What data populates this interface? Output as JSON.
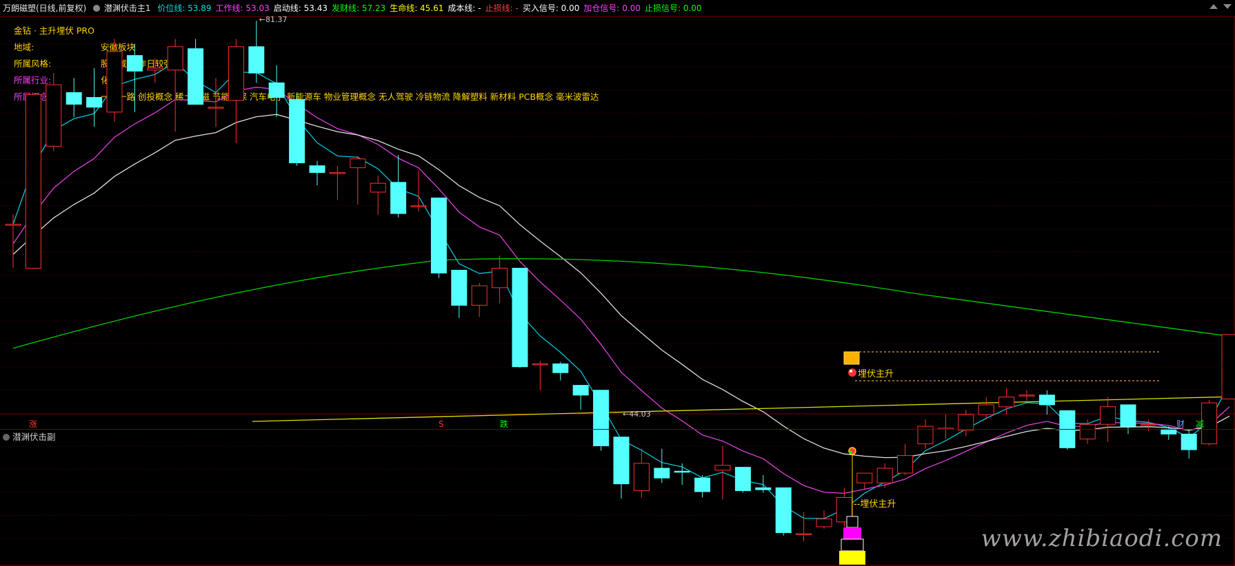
{
  "header": {
    "app_title": "万朗磁塑(日线,前复权)",
    "indicator_name": "潜渊伏击主1",
    "items": [
      {
        "label": "价位线: 53.89",
        "color": "#00e0e0"
      },
      {
        "label": "工作线: 53.03",
        "color": "#ff40ff"
      },
      {
        "label": "启动线: 53.43",
        "color": "#ffffff"
      },
      {
        "label": "发财线: 57.23",
        "color": "#00ff00"
      },
      {
        "label": "生命线: 45.61",
        "color": "#ffff00"
      },
      {
        "label": "成本线: -",
        "color": "#ffffff"
      },
      {
        "label": "止损线: -",
        "color": "#ff4040"
      },
      {
        "label": "买入信号: 0.00",
        "color": "#ffffff"
      },
      {
        "label": "加仓信号: 0.00",
        "color": "#ff40ff"
      },
      {
        "label": "止损信号: 0.00",
        "color": "#00ff00"
      }
    ]
  },
  "info": {
    "line1": "金钻 · 主升埋伏 PRO",
    "region_label": "地域:",
    "region_value": "安徽板块",
    "style_label": "所属风格:",
    "style_value": "股东减持 昨日较强",
    "industry_label": "所属行业:",
    "industry_value": "化工",
    "concept_label": "所属概念:",
    "concept_value": "一带一路 创投概念 稀土永磁 节能环保 汽车电子 新能源车 物业管理概念 无人驾驶 冷链物流 降解塑料 新材料 PCB概念 毫米波雷达"
  },
  "annotations": {
    "high": "81.37",
    "low": "44.03",
    "signal": "埋伏主升"
  },
  "bottom_markers": {
    "zhang": "涨",
    "s": "S",
    "die": "跌",
    "cai": "财",
    "jian": "减"
  },
  "sub_panel": {
    "title": "潜渊伏击副",
    "signal": "--埋伏主升"
  },
  "watermark": "www.zhibiaodi.com",
  "colors": {
    "up": "#ff3030",
    "down": "#54ffff",
    "price_line": "#00c8d8",
    "work_line": "#e040e0",
    "start_line": "#e0e0e0",
    "fortune_line": "#00d000",
    "life_line": "#e0e000",
    "grid": "#5a0000"
  },
  "candles": [
    [
      60.5,
      60.5,
      56.0,
      61.5
    ],
    [
      56.0,
      73.8,
      56.0,
      73.8
    ],
    [
      68.5,
      74.8,
      68.0,
      76.0
    ],
    [
      74.0,
      72.8,
      71.5,
      75.5
    ],
    [
      73.5,
      72.5,
      70.5,
      76.5
    ],
    [
      72.0,
      78.2,
      71.0,
      79.5
    ],
    [
      77.8,
      76.2,
      72.0,
      79.0
    ],
    [
      76.3,
      76.5,
      75.0,
      77.5
    ],
    [
      76.3,
      78.7,
      70.0,
      79.5
    ],
    [
      78.5,
      72.8,
      73.0,
      79.5
    ],
    [
      72.5,
      72.5,
      70.5,
      75.5
    ],
    [
      73.2,
      78.7,
      68.8,
      79.5
    ],
    [
      78.7,
      76.0,
      75.0,
      81.37
    ],
    [
      75.0,
      73.5,
      71.5,
      76.8
    ],
    [
      73.3,
      66.8,
      66.5,
      74.0
    ],
    [
      66.5,
      65.8,
      64.5,
      67.0
    ],
    [
      65.8,
      65.8,
      63.0,
      66.5
    ],
    [
      66.3,
      67.2,
      62.5,
      67.5
    ],
    [
      63.8,
      64.7,
      61.5,
      65.5
    ],
    [
      64.8,
      61.6,
      61.2,
      67.6
    ],
    [
      62.4,
      62.4,
      61.8,
      66.0
    ],
    [
      63.2,
      55.5,
      55.0,
      63.2
    ],
    [
      55.8,
      52.2,
      50.9,
      55.8
    ],
    [
      52.2,
      54.2,
      51.0,
      54.5
    ],
    [
      54.0,
      56.0,
      52.4,
      57.3
    ],
    [
      56.0,
      45.9,
      45.8,
      56.0
    ],
    [
      46.2,
      46.2,
      43.5,
      46.5
    ],
    [
      46.2,
      45.3,
      44.5,
      46.4
    ],
    [
      44.0,
      43.0,
      41.5,
      44.0
    ],
    [
      43.5,
      37.8,
      37.3,
      43.5
    ],
    [
      38.7,
      33.9,
      32.4,
      38.7
    ],
    [
      33.2,
      36.0,
      32.5,
      37.5
    ],
    [
      35.5,
      34.5,
      34.0,
      37.5
    ],
    [
      35.2,
      35.1,
      33.8,
      36.0
    ],
    [
      34.5,
      33.1,
      32.5,
      34.8
    ],
    [
      35.3,
      35.8,
      32.3,
      37.8
    ],
    [
      35.6,
      33.2,
      33.0,
      35.6
    ],
    [
      33.5,
      33.3,
      33.0,
      34.8
    ],
    [
      33.5,
      28.9,
      28.6,
      33.5
    ],
    [
      28.8,
      28.8,
      28.0,
      31.0
    ],
    [
      29.5,
      30.3,
      29.3,
      31.2
    ],
    [
      30.0,
      32.5,
      29.5,
      33.5
    ],
    [
      34.0,
      35.0,
      33.4,
      35.0
    ],
    [
      34.0,
      35.5,
      33.5,
      36.0
    ],
    [
      35.0,
      36.8,
      34.8,
      38.0
    ],
    [
      38.0,
      39.8,
      37.5,
      40.5
    ],
    [
      39.6,
      39.6,
      38.5,
      41.0
    ],
    [
      39.4,
      41.0,
      38.8,
      41.5
    ],
    [
      41.0,
      42.0,
      40.5,
      42.8
    ],
    [
      41.8,
      42.8,
      41.0,
      43.7
    ],
    [
      43.0,
      43.0,
      42.4,
      43.5
    ],
    [
      43.0,
      42.0,
      41.0,
      43.5
    ],
    [
      41.4,
      37.6,
      37.4,
      41.4
    ],
    [
      38.5,
      40.0,
      38.0,
      40.5
    ],
    [
      40.0,
      41.8,
      38.2,
      42.8
    ],
    [
      42.0,
      39.8,
      39.0,
      42.0
    ],
    [
      40.0,
      40.0,
      39.3,
      40.5
    ],
    [
      39.5,
      39.0,
      38.4,
      39.8
    ],
    [
      39.0,
      37.4,
      36.5,
      39.5
    ],
    [
      38.0,
      42.2,
      37.8,
      42.5
    ],
    [
      42.6,
      49.2,
      42.6,
      49.2
    ]
  ]
}
